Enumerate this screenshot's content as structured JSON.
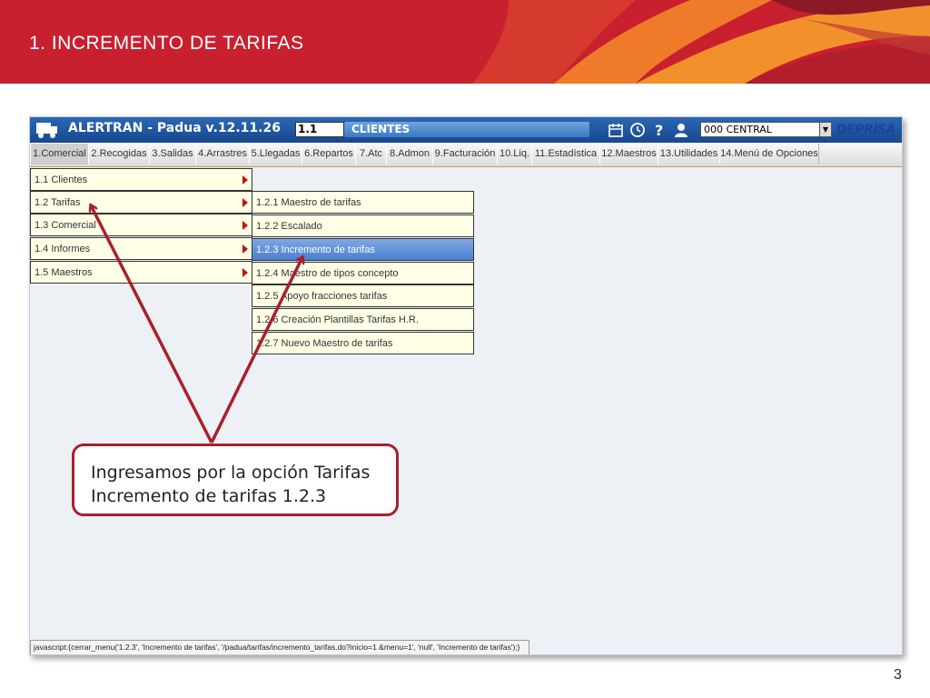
{
  "slide": {
    "title": "1. INCREMENTO DE TARIFAS",
    "page_number": "3",
    "colors": {
      "header_red": "#c8202f",
      "callout_border": "#a8202c"
    }
  },
  "app": {
    "title": "ALERTRAN - Padua  v.12.11.26",
    "menu_code": "1.1",
    "section": "CLIENTES",
    "office": "000 CENTRAL",
    "brand": "DEPRISA",
    "icons": [
      "calendar-icon",
      "clock-icon",
      "help-icon",
      "user-icon"
    ],
    "tabs": [
      "1.Comercial",
      "2.Recogidas",
      "3.Salidas",
      "4.Arrastres",
      "5.Llegadas",
      "6.Repartos",
      "7.Atc",
      "8.Admon",
      "9.Facturación",
      "10.Liq.",
      "11.Estadística",
      "12.Maestros",
      "13.Utilidades",
      "14.Menú de Opciones"
    ],
    "active_tab": "1.Comercial",
    "menu": [
      {
        "label": "1.1 Clientes"
      },
      {
        "label": "1.2 Tarifas"
      },
      {
        "label": "1.3 Comercial"
      },
      {
        "label": "1.4 Informes"
      },
      {
        "label": "1.5 Maestros"
      }
    ],
    "submenu": [
      {
        "label": "1.2.1 Maestro de tarifas"
      },
      {
        "label": "1.2.2 Escalado"
      },
      {
        "label": "1.2.3 Incremento de tarifas",
        "highlighted": true
      },
      {
        "label": "1.2.4 Maestro de tipos concepto"
      },
      {
        "label": "1.2.5 Apoyo fracciones tarifas"
      },
      {
        "label": "1.2.6 Creación Plantillas Tarifas H.R."
      },
      {
        "label": "1.2.7 Nuevo Maestro de tarifas"
      }
    ],
    "status_text": "javascript:{cerrar_menu('1.2.3', 'Incremento de tarifas', '/padua/tarifas/incremento_tarifas.do?inicio=1  &menu=1', 'null', 'Incremento de tarifas');}"
  },
  "callout": {
    "line1": "Ingresamos por la opción Tarifas",
    "line2": "Incremento de tarifas 1.2.3"
  }
}
